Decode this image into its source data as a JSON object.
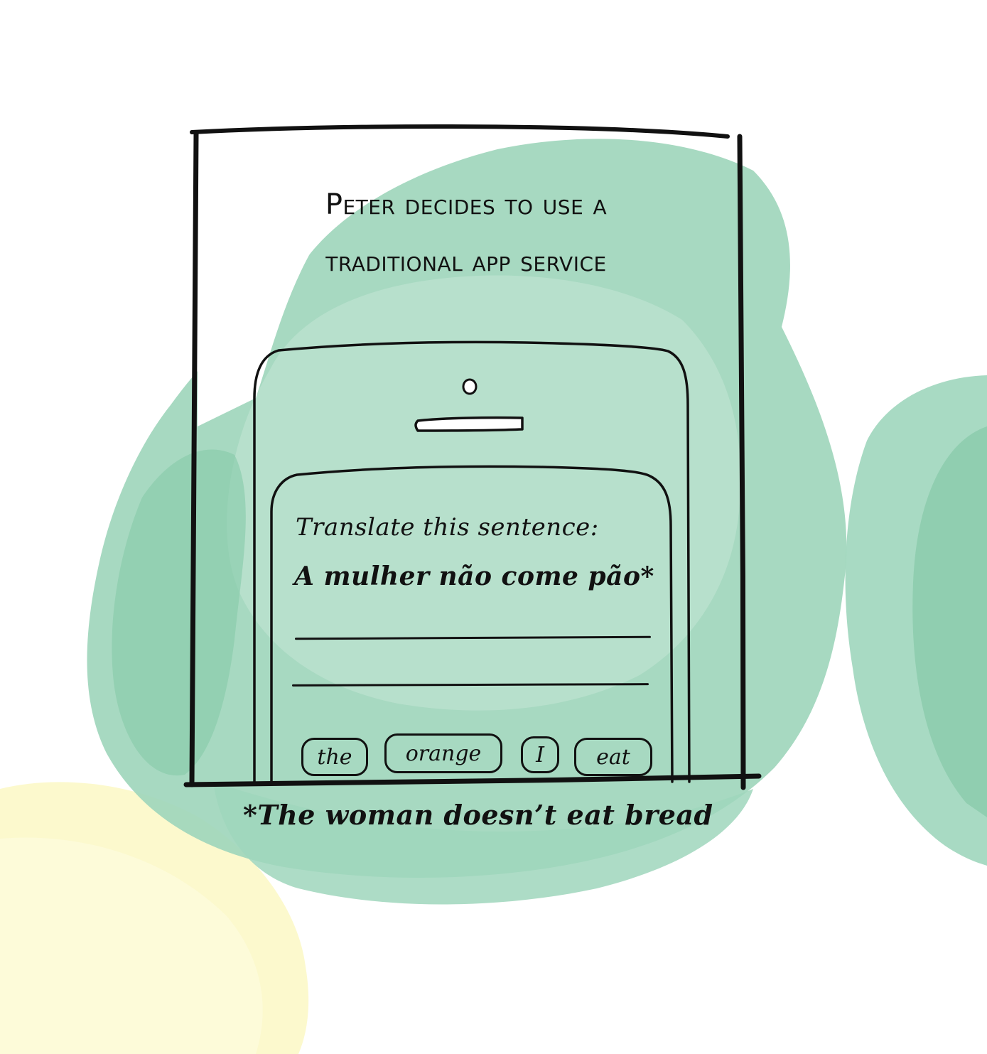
{
  "panel": {
    "title_line_1": "Peter decides to use a",
    "title_line_2": "traditional app service"
  },
  "phone": {
    "screen": {
      "prompt_label": "Translate this sentence:",
      "source_sentence": "A mulher não come pão*",
      "answer_lines_count": 2,
      "word_bank": [
        "the",
        "orange",
        "I",
        "eat"
      ]
    }
  },
  "footnote": "*The woman doesn’t eat bread",
  "colors": {
    "watercolor_green": "#8fcfb0",
    "watercolor_green_light": "#c5e6d6",
    "watercolor_yellow": "#fbf8c4",
    "ink": "#111111",
    "background": "#ffffff"
  }
}
